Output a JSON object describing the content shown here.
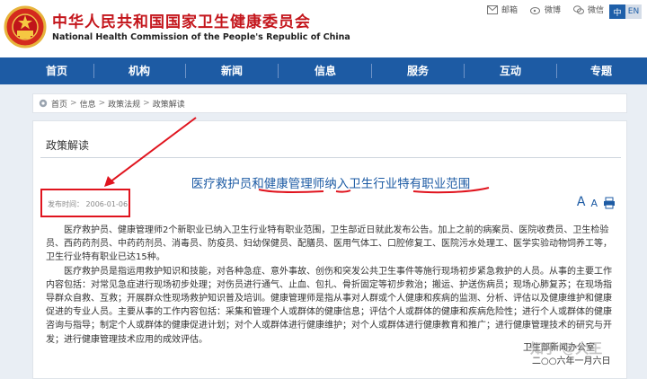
{
  "header": {
    "site_title_cn": "中华人民共和国国家卫生健康委员会",
    "site_title_en": "National Health Commission of the People's Republic of China",
    "top_links": [
      {
        "icon": "mail-icon",
        "label": "邮箱"
      },
      {
        "icon": "weibo-icon",
        "label": "微博"
      },
      {
        "icon": "wechat-icon",
        "label": "微信"
      }
    ],
    "lang": {
      "active": "中",
      "inactive": "EN"
    }
  },
  "nav": {
    "items": [
      "首页",
      "机构",
      "新闻",
      "信息",
      "服务",
      "互动",
      "专题"
    ]
  },
  "breadcrumb": [
    "首页",
    "信息",
    "政策法规",
    "政策解读"
  ],
  "panel": {
    "section_title": "政策解读",
    "article_title": "医疗救护员和健康管理师纳入卫生行业特有职业范围",
    "pub_date": "发布时间： 2006-01-06",
    "font_large": "A",
    "font_small": "A",
    "paragraphs": [
      "医疗救护员、健康管理师2个新职业已纳入卫生行业特有职业范围，卫生部近日就此发布公告。加上之前的病案员、医院收费员、卫生检验员、西药药剂员、中药药剂员、消毒员、防疫员、妇幼保健员、配膳员、医用气体工、口腔修复工、医院污水处理工、医学实验动物饲养工等，卫生行业特有职业已达15种。",
      "医疗救护员是指运用救护知识和技能，对各种急症、意外事故、创伤和突发公共卫生事件等施行现场初步紧急救护的人员。从事的主要工作内容包括：对常见急症进行现场初步处理；对伤员进行通气、止血、包扎、骨折固定等初步救治；搬运、护送伤病员；现场心肺复苏；在现场指导群众自救、互救；开展群众性现场救护知识普及培训。健康管理师是指从事对人群或个人健康和疾病的监测、分析、评估以及健康维护和健康促进的专业人员。主要从事的工作内容包括：采集和管理个人或群体的健康信息；评估个人或群体的健康和疾病危险性；进行个人或群体的健康咨询与指导；制定个人或群体的健康促进计划；对个人或群体进行健康维护；对个人或群体进行健康教育和推广；进行健康管理技术的研究与开发；进行健康管理技术应用的成效评估。"
    ],
    "sign_office": "卫生部新闻办公室",
    "sign_date": "二○○六年一月六日"
  },
  "watermark": "知乎 @大王",
  "colors": {
    "brand_red": "#c4161c",
    "nav_blue": "#1d5ba4",
    "title_blue": "#1d5ba4",
    "annotation_red": "#e0141e"
  }
}
